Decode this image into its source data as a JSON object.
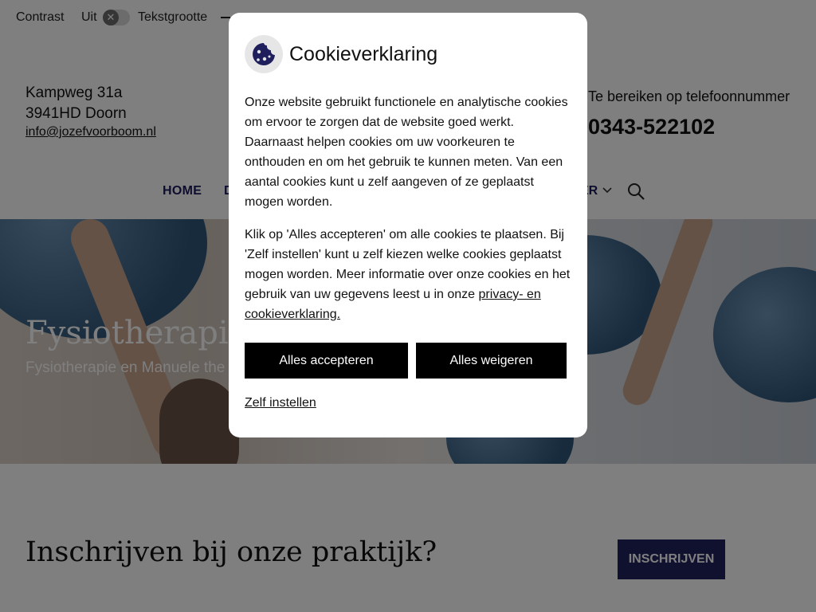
{
  "topbar": {
    "contrast_label": "Contrast",
    "contrast_state": "Uit",
    "toggle_glyph": "✕",
    "textsize_label": "Tekstgrootte"
  },
  "contact": {
    "street": "Kampweg 31a",
    "city": "3941HD Doorn",
    "email": "info@jozefvoorboom.nl",
    "reach_text": "Te bereiken op telefoonnummer",
    "phone": "0343-522102"
  },
  "nav": {
    "home": "HOME",
    "visible_fragment_left": "D",
    "visible_fragment_right": "ER"
  },
  "hero": {
    "title": "Fysiotherapie J",
    "subtitle": "Fysiotherapie en Manuele the"
  },
  "cta": {
    "title": "Inschrijven bij onze praktijk?",
    "button": "INSCHRIJVEN"
  },
  "cookie": {
    "title": "Cookieverklaring",
    "paragraph1": "Onze website gebruikt functionele en analytische cookies om ervoor te zorgen dat de website goed werkt. Daarnaast helpen cookies om uw voorkeuren te onthouden en om het gebruik te kunnen meten. Van een aantal cookies kunt u zelf aangeven of ze geplaatst mogen worden.",
    "paragraph2": "Klik op 'Alles accepteren' om alle cookies te plaatsen. Bij 'Zelf instellen' kunt u zelf kiezen welke cookies geplaatst mogen worden. Meer informatie over onze cookies en het gebruik van uw gegevens leest u in onze ",
    "privacy_link": "privacy- en cookieverklaring.",
    "accept_button": "Alles accepteren",
    "deny_button": "Alles weigeren",
    "custom_link": "Zelf instellen"
  },
  "colors": {
    "brand_navy": "#20225e",
    "modal_button": "#000000",
    "cookie_icon": "#1e1f5c"
  }
}
